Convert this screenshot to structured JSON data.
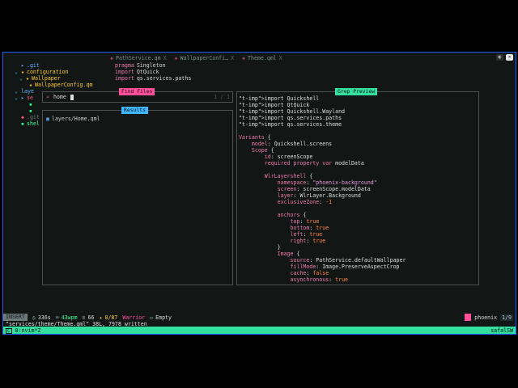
{
  "tabs": [
    {
      "name": "PathService.qm",
      "close": "X"
    },
    {
      "name": "WallpaperConfi…",
      "close": "X"
    },
    {
      "name": "Theme.qml",
      "close": "X"
    }
  ],
  "tree": [
    {
      "fold": "",
      "icon": "▸",
      "name": ".git",
      "cls": "dir"
    },
    {
      "fold": "⌄",
      "icon": "★",
      "name": "configuration",
      "cls": "yellow"
    },
    {
      "fold": "⌄",
      "icon": "★",
      "name": "Wallpaper",
      "cls": "yellow"
    },
    {
      "fold": "",
      "icon": "★",
      "name": "WallpaperConfig.qm",
      "cls": "yellow"
    },
    {
      "fold": "⌄",
      "icon": "▸",
      "name": "laye",
      "cls": "dir"
    },
    {
      "fold": "⌄",
      "icon": "▸",
      "name": "se",
      "cls": "red"
    },
    {
      "fold": "",
      "icon": "▸",
      "name": "",
      "cls": "dir"
    },
    {
      "fold": "",
      "icon": "▸",
      "name": "",
      "cls": "dir"
    },
    {
      "fold": "",
      "icon": "◆",
      "name": ".git",
      "cls": "muted"
    },
    {
      "fold": "",
      "icon": "▸",
      "name": "shel",
      "cls": "green"
    }
  ],
  "code": [
    {
      "n": "",
      "kw": "pragma",
      "rest": "Singleton"
    },
    {
      "n": "",
      "kw": "import",
      "rest": "QtQuick"
    },
    {
      "n": "",
      "kw": "import",
      "rest": "qs.services.paths"
    }
  ],
  "find": {
    "title": "Find Files",
    "query": "home",
    "count": "1 / 1"
  },
  "results": {
    "title": "Results",
    "item": "layers/Home.qml"
  },
  "preview": {
    "title": "Grep Preview",
    "lines": [
      "import Quickshell",
      "import QtQuick",
      "import Quickshell.Wayland",
      "import qs.services.paths",
      "import qs.services.theme",
      "",
      "Variants {",
      "    model: Quickshell.screens",
      "    Scope {",
      "        id: screenScope",
      "        required property var modelData",
      "",
      "        WlrLayershell {",
      "            namespace: \"phoenix-background\"",
      "            screen: screenScope.modelData",
      "            layer: WlrLayer.Background",
      "            exclusiveZone: -1",
      "",
      "            anchors {",
      "                top: true",
      "                bottom: true",
      "                left: true",
      "                right: true",
      "            }",
      "            Image {",
      "                source: PathService.defaultWallpaper",
      "                fillMode: Image.PreserveAspectCrop",
      "                cache: false",
      "                asynchronous: true"
    ]
  },
  "status": {
    "mode": "INSERT",
    "time": "336s",
    "net": "43wpm",
    "num1": "66",
    "num2": "0/87",
    "warrior": "Warrior",
    "empty": "Empty",
    "session": "phoenix",
    "pos": "1/9"
  },
  "message": "\"services/theme/Theme.qml\" 38L, 7978 written",
  "tmux": {
    "win": "0:nvim*Z",
    "host": "safalSW"
  },
  "colors": {
    "accent": "#33e0a0",
    "pink": "#ff4f9a",
    "border": "#1c5fff"
  }
}
